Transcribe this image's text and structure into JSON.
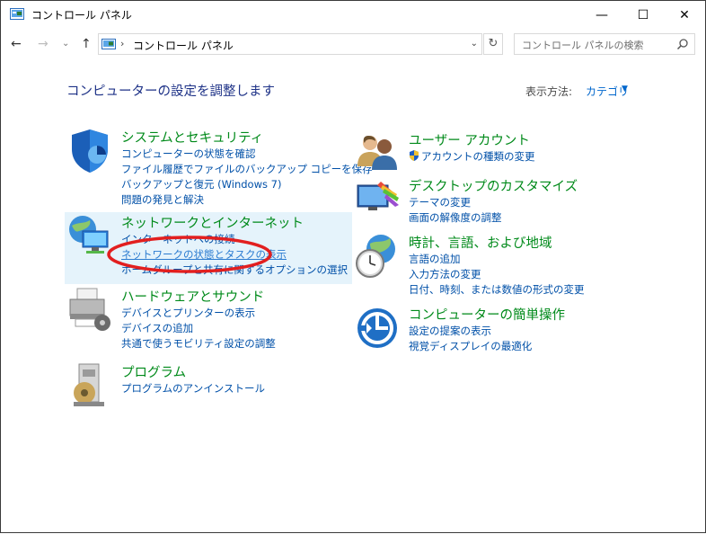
{
  "window": {
    "title": "コントロール パネル",
    "minimize": "—",
    "maximize": "☐",
    "close": "✕"
  },
  "nav": {
    "back": "←",
    "forward": "→",
    "recent": "⌄",
    "up": "↑",
    "separator": "›",
    "breadcrumb": "コントロール パネル",
    "address_dropdown": "⌄",
    "refresh": "↻",
    "search_placeholder": "コントロール パネルの検索"
  },
  "page": {
    "heading": "コンピューターの設定を調整します",
    "view_by_label": "表示方法:",
    "view_by_value": "カテゴリ"
  },
  "categories_left": [
    {
      "title": "システムとセキュリティ",
      "links": [
        "コンピューターの状態を確認",
        "ファイル履歴でファイルのバックアップ コピーを保存",
        "バックアップと復元 (Windows 7)",
        "問題の発見と解決"
      ]
    },
    {
      "title": "ネットワークとインターネット",
      "links": [
        "インターネットへの接続",
        "ネットワークの状態とタスクの表示",
        "ホームグループと共有に関するオプションの選択"
      ]
    },
    {
      "title": "ハードウェアとサウンド",
      "links": [
        "デバイスとプリンターの表示",
        "デバイスの追加",
        "共通で使うモビリティ設定の調整"
      ]
    },
    {
      "title": "プログラム",
      "links": [
        "プログラムのアンインストール"
      ]
    }
  ],
  "categories_right": [
    {
      "title": "ユーザー アカウント",
      "links": [
        "アカウントの種類の変更"
      ]
    },
    {
      "title": "デスクトップのカスタマイズ",
      "links": [
        "テーマの変更",
        "画面の解像度の調整"
      ]
    },
    {
      "title": "時計、言語、および地域",
      "links": [
        "言語の追加",
        "入力方法の変更",
        "日付、時刻、または数値の形式の変更"
      ]
    },
    {
      "title": "コンピューターの簡単操作",
      "links": [
        "設定の提案の表示",
        "視覚ディスプレイの最適化"
      ]
    }
  ],
  "colors": {
    "category_title": "#008a1a",
    "link": "#0050a8",
    "heading": "#1e3287",
    "highlight": "#e5f3fb",
    "annotation": "#e21f1f"
  }
}
